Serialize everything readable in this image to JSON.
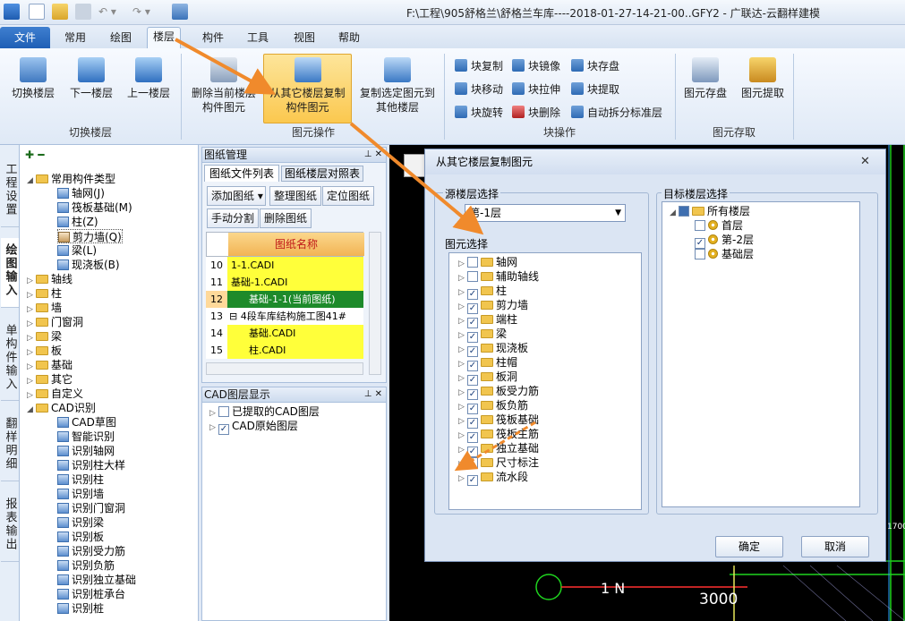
{
  "window": {
    "title": "F:\\工程\\905舒格兰\\舒格兰车库----2018-01-27-14-21-00..GFY2 - 广联达-云翻样建模"
  },
  "menu": {
    "file": "文件",
    "items": [
      "常用",
      "绘图",
      "楼层",
      "构件",
      "工具",
      "视图",
      "帮助"
    ]
  },
  "ribbon": {
    "floor_switch": {
      "label": "切换楼层",
      "buttons": [
        "切换楼层",
        "下一楼层",
        "上一楼层"
      ]
    },
    "element_ops": {
      "label": "图元操作",
      "buttons": [
        "删除当前楼层\n构件图元",
        "从其它楼层复制\n构件图元",
        "复制选定图元到\n其他楼层"
      ]
    },
    "block_ops": {
      "label": "块操作",
      "buttons": [
        "块复制",
        "块镜像",
        "块存盘",
        "块移动",
        "块拉伸",
        "块提取",
        "块旋转",
        "块删除",
        "自动拆分标准层"
      ]
    },
    "element_store": {
      "label": "图元存取",
      "buttons": [
        "图元存盘",
        "图元提取"
      ]
    }
  },
  "side_tabs": [
    "工程设置",
    "绘图输入",
    "单构件输入",
    "翻样明细",
    "报表输出"
  ],
  "tree": {
    "root": "常用构件类型",
    "common": [
      "轴网(J)",
      "筏板基础(M)",
      "柱(Z)",
      "剪力墙(Q)",
      "梁(L)",
      "现浇板(B)"
    ],
    "folders": [
      "轴线",
      "柱",
      "墙",
      "门窗洞",
      "梁",
      "板",
      "基础",
      "其它",
      "自定义"
    ],
    "cad_root": "CAD识别",
    "cad_items": [
      "CAD草图",
      "智能识别",
      "识别轴网",
      "识别柱大样",
      "识别柱",
      "识别墙",
      "识别门窗洞",
      "识别梁",
      "识别板",
      "识别受力筋",
      "识别负筋",
      "识别独立基础",
      "识别桩承台",
      "识别桩"
    ]
  },
  "drawing_panel": {
    "title": "图纸管理",
    "tabs": [
      "图纸文件列表",
      "图纸楼层对照表"
    ],
    "buttons": [
      "添加图纸",
      "整理图纸",
      "定位图纸",
      "手动分割",
      "删除图纸"
    ],
    "column_header": "图纸名称",
    "rows": [
      {
        "n": "10",
        "name": "1-1.CADI"
      },
      {
        "n": "11",
        "name": "基础-1.CADI"
      },
      {
        "n": "12",
        "name": "基础-1-1(当前图纸)"
      },
      {
        "n": "13",
        "name": "4段车库结构施工图41#"
      },
      {
        "n": "14",
        "name": "基础.CADI"
      },
      {
        "n": "15",
        "name": "柱.CADI"
      }
    ]
  },
  "cad_panel": {
    "title": "CAD图层显示",
    "items": [
      "已提取的CAD图层",
      "CAD原始图层"
    ]
  },
  "dialog": {
    "title": "从其它楼层复制图元",
    "source_label": "源楼层选择",
    "source_value": "第-1层",
    "elements_label": "图元选择",
    "elements": [
      {
        "name": "轴网",
        "checked": false
      },
      {
        "name": "辅助轴线",
        "checked": false
      },
      {
        "name": "柱",
        "checked": true
      },
      {
        "name": "剪力墙",
        "checked": true
      },
      {
        "name": "端柱",
        "checked": true
      },
      {
        "name": "梁",
        "checked": true
      },
      {
        "name": "现浇板",
        "checked": true
      },
      {
        "name": "柱帽",
        "checked": true
      },
      {
        "name": "板洞",
        "checked": true
      },
      {
        "name": "板受力筋",
        "checked": true
      },
      {
        "name": "板负筋",
        "checked": true
      },
      {
        "name": "筏板基础",
        "checked": true
      },
      {
        "name": "筏板主筋",
        "checked": true
      },
      {
        "name": "独立基础",
        "checked": true
      },
      {
        "name": "尺寸标注",
        "checked": false
      },
      {
        "name": "流水段",
        "checked": true
      }
    ],
    "target_label": "目标楼层选择",
    "target_root": "所有楼层",
    "targets": [
      {
        "name": "首层",
        "checked": false
      },
      {
        "name": "第-2层",
        "checked": true
      },
      {
        "name": "基础层",
        "checked": false
      }
    ],
    "ok": "确定",
    "cancel": "取消"
  },
  "cad_texts": {
    "axis": "1 N",
    "dim": "3000",
    "right_dim": "1700"
  },
  "colors": {
    "annotation_arrow": "#f08a2c",
    "highlight": "#fbc84f",
    "row_yellow": "#ffff3a",
    "row_green": "#1d8a2a"
  }
}
